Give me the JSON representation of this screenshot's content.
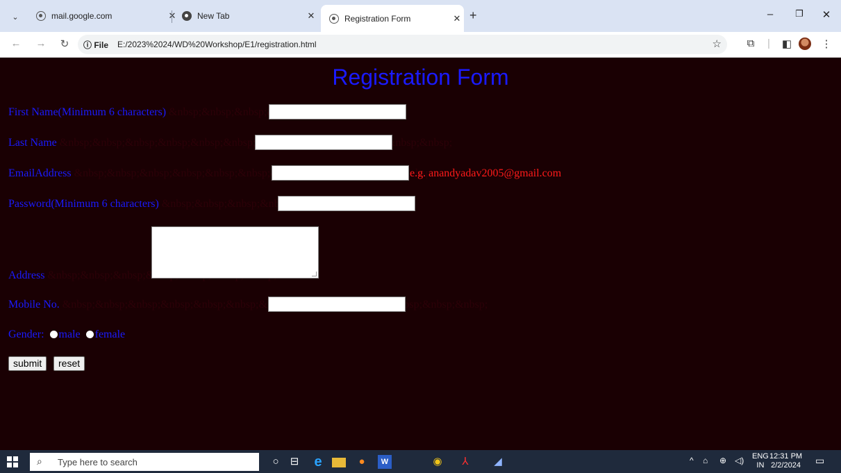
{
  "browser": {
    "tabs": [
      {
        "label": "mail.google.com"
      },
      {
        "label": "New Tab"
      },
      {
        "label": "Registration Form"
      }
    ],
    "new_tab_symbol": "+",
    "address": {
      "chip": "ⓘ File",
      "url": "E:/2023%2024/WD%20Workshop/E1/registration.html"
    }
  },
  "form": {
    "title": "Registration Form",
    "first_name_label": "First Name(Minimum 6 characters)",
    "last_name_label": "Last Name",
    "email_label": "EmailAddress",
    "email_hint": "e.g. anandyadav2005@gmail.com",
    "password_label": "Password(Minimum 6 characters)",
    "address_label": "Address",
    "mobile_label": "Mobile No.",
    "gender_label": "Gender:",
    "gender_options": [
      "male",
      "female"
    ],
    "submit_label": "submit",
    "reset_label": "reset",
    "filler": {
      "first_name": "&nbsp;&nbsp;&nbsp;&nbsp;",
      "last_name": "&nbsp;&nbsp;&nbsp;&nbsp;&nbsp;&nbsp;&nbsp;&nbsp;&nbsp;&nbsp;&nbsp;&nbsp;",
      "email": "&nbsp;&nbsp;&nbsp;&nbsp;&nbsp;&nbsp;&nbsp;&nbsp;&nbsp;&nbsp;&nbsp;",
      "password": "&nbsp;&nbsp;&nbsp;&nbsp;&nbsp;&nbsp;",
      "address": "&nbsp;&nbsp;&nbsp;&nbsp;&nbsp;&nbsp;&nbsp;",
      "mobile": "&nbsp;&nbsp;&nbsp;&nbsp;&nbsp;&nbsp;&nbsp;&nbsp;&nbsp;&nbsp;&nbsp;&nbsp;&nbsp;"
    }
  },
  "taskbar": {
    "search_placeholder": "Type here to search",
    "language": {
      "line1": "ENG",
      "line2": "IN"
    },
    "clock": {
      "time": "12:31 PM",
      "date": "2/2/2024"
    }
  },
  "colors": {
    "page_background": "#1a0003",
    "label_blue": "#1a1aff",
    "hint_red": "#ff1a1a"
  }
}
